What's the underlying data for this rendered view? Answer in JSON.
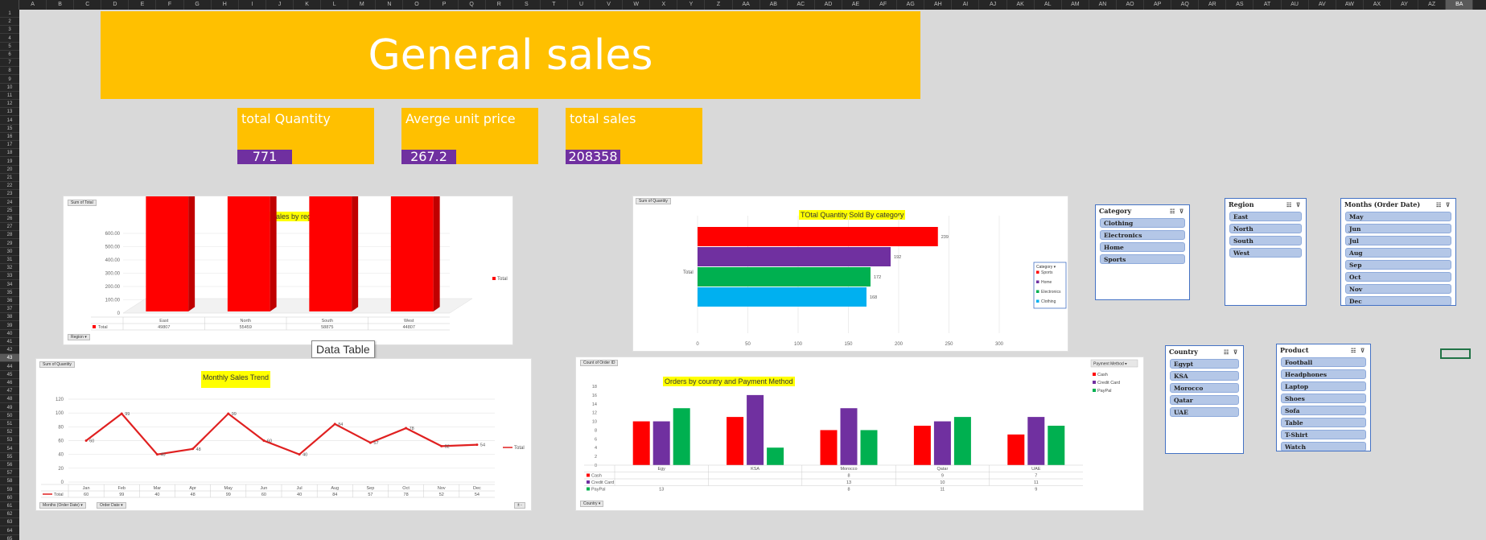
{
  "sheet": {
    "columns": [
      "A",
      "B",
      "C",
      "D",
      "E",
      "F",
      "G",
      "H",
      "I",
      "J",
      "K",
      "L",
      "M",
      "N",
      "O",
      "P",
      "Q",
      "R",
      "S",
      "T",
      "U",
      "V",
      "W",
      "X",
      "Y",
      "Z",
      "AA",
      "AB",
      "AC",
      "AD",
      "AE",
      "AF",
      "AG",
      "AH",
      "AI",
      "AJ",
      "AK",
      "AL",
      "AM",
      "AN",
      "AO",
      "AP",
      "AQ",
      "AR",
      "AS",
      "AT",
      "AU",
      "AV",
      "AW",
      "AX",
      "AY",
      "AZ",
      "BA"
    ],
    "rows": [
      "1",
      "2",
      "3",
      "4",
      "5",
      "6",
      "7",
      "8",
      "9",
      "10",
      "11",
      "12",
      "13",
      "14",
      "15",
      "16",
      "17",
      "18",
      "19",
      "20",
      "21",
      "22",
      "23",
      "24",
      "25",
      "26",
      "27",
      "28",
      "29",
      "30",
      "31",
      "32",
      "33",
      "34",
      "35",
      "36",
      "37",
      "38",
      "39",
      "40",
      "41",
      "42",
      "43",
      "44",
      "45",
      "46",
      "47",
      "48",
      "49",
      "50",
      "51",
      "52",
      "53",
      "54",
      "55",
      "56",
      "57",
      "58",
      "59",
      "60",
      "61",
      "62",
      "63",
      "64",
      "65"
    ],
    "selected_column": "BA",
    "selected_row": "43"
  },
  "title": "General sales",
  "kpis": [
    {
      "label": "total Quantity",
      "value": "771"
    },
    {
      "label": "Averge unit price",
      "value": "267.2"
    },
    {
      "label": "total sales",
      "value": "208358"
    }
  ],
  "tooltip": "Data Table",
  "charts": {
    "region": {
      "field_top": "Sum of Total",
      "field_bottom": "Region",
      "title": "Total sales by region",
      "yticks": [
        "0",
        "100.00",
        "200.00",
        "300.00",
        "400.00",
        "500.00",
        "600.00"
      ],
      "legend": "Total",
      "table_label": "Total",
      "colors": {
        "bar": "#ff0000",
        "side": "#c00000",
        "top": "#ff3333"
      }
    },
    "category": {
      "field_top": "Sum of Quantity",
      "title": "TOtal Quantity Sold By category",
      "axis_label": "Total",
      "xticks": [
        "0",
        "50",
        "100",
        "150",
        "200",
        "250",
        "300"
      ],
      "legend_title": "Category"
    },
    "monthly": {
      "field_top": "Sum of Quantity",
      "field_months": "Months (Order Date)",
      "field_order": "Order Date",
      "title": "Monthly Sales Trend",
      "yticks": [
        "0",
        "20",
        "40",
        "60",
        "80",
        "100",
        "120"
      ],
      "legend": "Total",
      "table_label": "Total",
      "line_color": "#e02020"
    },
    "country": {
      "field_top": "Count of Order ID",
      "field_bottom": "Country",
      "title": "Orders by country and Payment Method",
      "yticks": [
        "0",
        "2",
        "4",
        "6",
        "8",
        "10",
        "12",
        "14",
        "16",
        "18"
      ],
      "legend_title": "Payment Method"
    }
  },
  "chart_data": [
    {
      "type": "bar",
      "title": "Total sales by region",
      "categories": [
        "East",
        "North",
        "South",
        "West"
      ],
      "series": [
        {
          "name": "Total",
          "values": [
            49807,
            55459,
            58875,
            44807
          ]
        }
      ],
      "table_values": [
        "49807",
        "55459",
        "58875",
        "44807"
      ],
      "ylim": [
        0,
        600
      ]
    },
    {
      "type": "bar",
      "title": "TOtal Quantity Sold By category",
      "categories": [
        "Total"
      ],
      "series": [
        {
          "name": "Sports",
          "values": [
            239
          ],
          "color": "#ff0000"
        },
        {
          "name": "Home",
          "values": [
            192
          ],
          "color": "#7030a0"
        },
        {
          "name": "Electronics",
          "values": [
            172
          ],
          "color": "#00b050"
        },
        {
          "name": "Clothing",
          "values": [
            168
          ],
          "color": "#00b0f0"
        }
      ],
      "xlim": [
        0,
        300
      ]
    },
    {
      "type": "line",
      "title": "Monthly Sales Trend",
      "categories": [
        "Jan",
        "Feb",
        "Mar",
        "Apr",
        "May",
        "Jun",
        "Jul",
        "Aug",
        "Sep",
        "Oct",
        "Nov",
        "Dec"
      ],
      "series": [
        {
          "name": "Total",
          "values": [
            60,
            99,
            40,
            48,
            99,
            60,
            40,
            84,
            57,
            78,
            52,
            54
          ]
        }
      ],
      "ylim": [
        0,
        120
      ]
    },
    {
      "type": "bar",
      "title": "Orders by country and Payment Method",
      "categories": [
        "Egypt",
        "KSA",
        "Morocco",
        "Qatar",
        "UAE"
      ],
      "category_labels": [
        "Egy",
        "KSA",
        "Morocco",
        "Qatar",
        "UAE"
      ],
      "series": [
        {
          "name": "Cash",
          "values": [
            10,
            11,
            8,
            9,
            7
          ],
          "labels": [
            "",
            "",
            "8",
            "9",
            "7"
          ],
          "color": "#ff0000"
        },
        {
          "name": "Credit Card",
          "values": [
            10,
            16,
            13,
            10,
            11
          ],
          "labels": [
            "",
            "",
            "13",
            "10",
            "11"
          ],
          "color": "#7030a0"
        },
        {
          "name": "PayPal",
          "values": [
            13,
            4,
            8,
            11,
            9
          ],
          "labels": [
            "13",
            "",
            "8",
            "11",
            "9"
          ],
          "color": "#00b050"
        }
      ],
      "ylim": [
        0,
        18
      ]
    }
  ],
  "slicers": {
    "category": {
      "title": "Category",
      "items": [
        "Clothing",
        "Electronics",
        "Home",
        "Sports"
      ]
    },
    "region": {
      "title": "Region",
      "items": [
        "East",
        "North",
        "South",
        "West"
      ]
    },
    "months": {
      "title": "Months (Order Date)",
      "items": [
        "May",
        "Jun",
        "Jul",
        "Aug",
        "Sep",
        "Oct",
        "Nov",
        "Dec"
      ]
    },
    "country": {
      "title": "Country",
      "items": [
        "Egypt",
        "KSA",
        "Morocco",
        "Qatar",
        "UAE"
      ]
    },
    "product": {
      "title": "Product",
      "items": [
        "Football",
        "Headphones",
        "Laptop",
        "Shoes",
        "Sofa",
        "Table",
        "T-Shirt",
        "Watch"
      ]
    }
  }
}
